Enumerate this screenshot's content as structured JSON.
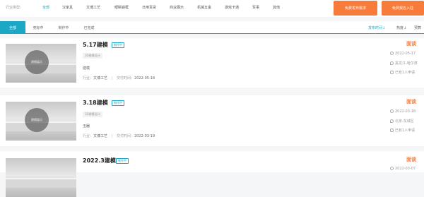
{
  "filter": {
    "label": "行业类型：",
    "options": [
      "全部",
      "汉家具",
      "文博工艺",
      "眼睛镜框",
      "日用百货",
      "商业展示",
      "机械五金",
      "游戏卡通",
      "军事",
      "其他"
    ],
    "post_button": "免费发布需求",
    "join_button": "免费报名入驻"
  },
  "tabs": [
    "全部",
    "竞标中",
    "制作中",
    "已完成"
  ],
  "sort": {
    "time": "发布时间↓",
    "hot": "热度↓",
    "budget": "预算"
  },
  "projects": [
    {
      "title": "5.17建模",
      "status": "制作中",
      "tag": "3D建模设计",
      "category": "建模",
      "industry_label": "行业：",
      "industry": "文博工艺",
      "delivery_label": "交付时间：",
      "delivery": "2022-05-18",
      "price": "面谈",
      "date": "2022-05-17",
      "location": "黑龙江-哈尔滨",
      "applicants": "已有1人申请",
      "thumb_text": "建模展示"
    },
    {
      "title": "3.18建模",
      "status": "制作中",
      "tag": "3D建模设计",
      "category": "玉器",
      "industry_label": "行业：",
      "industry": "文博工艺",
      "delivery_label": "交付时间：",
      "delivery": "2022-03-19",
      "price": "面谈",
      "date": "2022-03-18",
      "location": "北京-东城区",
      "applicants": "已有1人申请",
      "thumb_text": "建模展示"
    },
    {
      "title": "2022.3建模",
      "status": "制作中",
      "price": "面谈",
      "date": "2022-03-07"
    }
  ],
  "colors": {
    "accent": "#1ba8c7",
    "orange": "#f77c3b"
  }
}
